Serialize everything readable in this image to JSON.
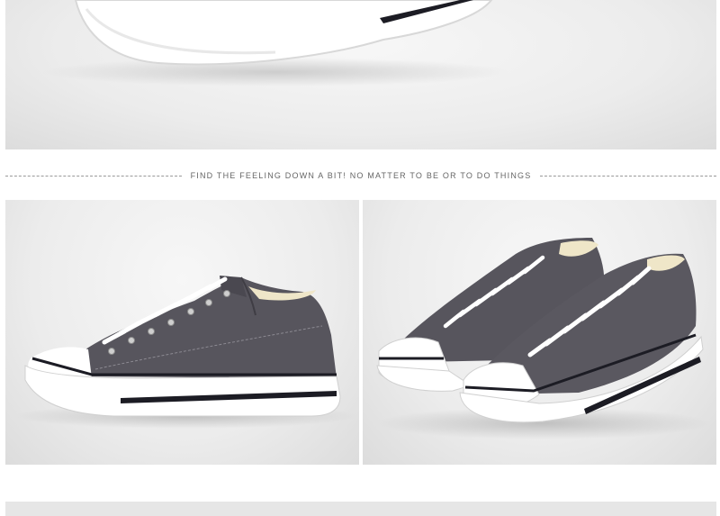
{
  "tagline": "FIND THE FEELING DOWN A BIT! NO MATTER TO BE OR TO DO THINGS",
  "colors": {
    "canvas": "#5a5860",
    "canvas_dark": "#3f3d44",
    "sole": "#ffffff",
    "stripe": "#1c1c24",
    "lining": "#efe6c8",
    "background": "#ededed"
  }
}
